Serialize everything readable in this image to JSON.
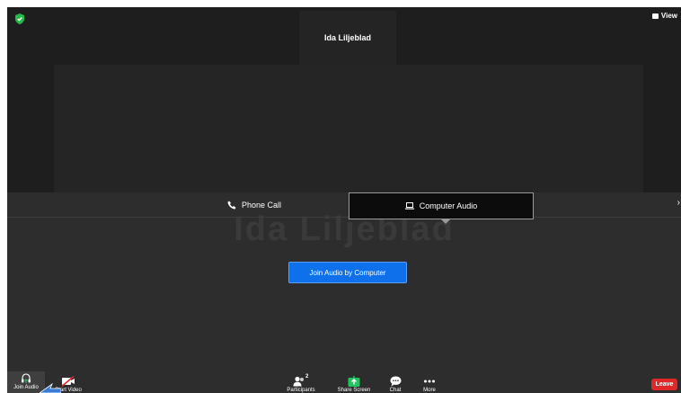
{
  "meeting": {
    "participant_name": "Ida Liljeblad",
    "watermark_name": "Ida Liljeblad",
    "view_label": "View"
  },
  "audio_panel": {
    "tabs": [
      {
        "label": "Phone Call",
        "icon": "phone-icon"
      },
      {
        "label": "Computer Audio",
        "icon": "laptop-icon",
        "selected": true
      }
    ],
    "join_button_label": "Join Audio by Computer"
  },
  "toolbar": {
    "join_audio": "Join Audio",
    "start_video": "Start Video",
    "participants": "Participants",
    "participants_count": "2",
    "share_screen": "Share Screen",
    "chat": "Chat",
    "more": "More",
    "leave": "Leave"
  },
  "colors": {
    "accent": "#0e71eb",
    "leave": "#e02828",
    "share_green": "#22c35e",
    "background": "#1e1e1e"
  }
}
